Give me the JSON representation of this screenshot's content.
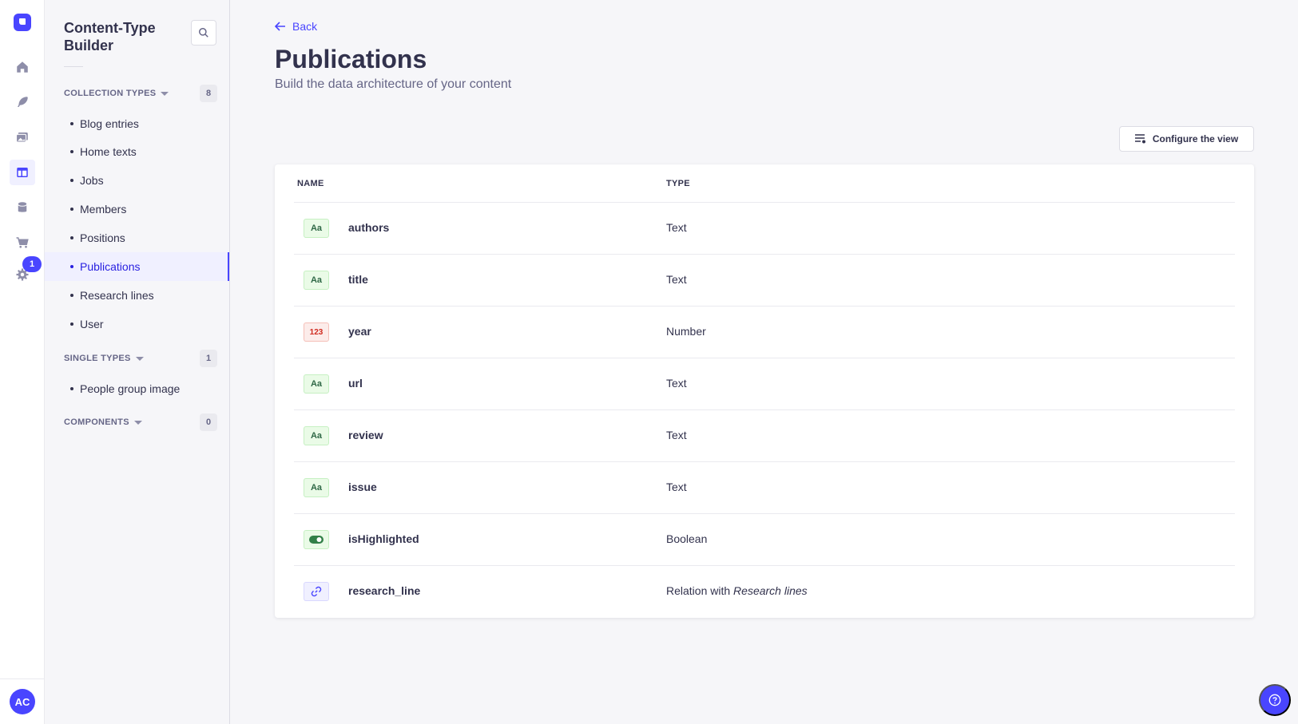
{
  "rail": {
    "avatar_initials": "AC",
    "settings_badge": "1",
    "items": [
      {
        "icon": "house-icon"
      },
      {
        "icon": "feather-icon"
      },
      {
        "icon": "media-icon"
      },
      {
        "icon": "layout-icon",
        "active": true
      },
      {
        "icon": "database-icon"
      },
      {
        "icon": "cart-icon"
      },
      {
        "icon": "gear-icon"
      }
    ]
  },
  "panel": {
    "title": "Content-Type Builder",
    "sections": {
      "collection": {
        "label": "COLLECTION TYPES",
        "count": "8"
      },
      "single": {
        "label": "SINGLE TYPES",
        "count": "1"
      },
      "components": {
        "label": "COMPONENTS",
        "count": "0"
      }
    },
    "collection_items": [
      "Blog entries",
      "Home texts",
      "Jobs",
      "Members",
      "Positions",
      "Publications",
      "Research lines",
      "User"
    ],
    "single_items": [
      "People group image"
    ]
  },
  "main": {
    "back_label": "Back",
    "title": "Publications",
    "subtitle": "Build the data architecture of your content",
    "configure_label": "Configure the view",
    "columns": {
      "name": "NAME",
      "type": "TYPE"
    },
    "fields": [
      {
        "name": "authors",
        "type": "Text",
        "icon": "Aa"
      },
      {
        "name": "title",
        "type": "Text",
        "icon": "Aa"
      },
      {
        "name": "year",
        "type": "Number",
        "icon": "123"
      },
      {
        "name": "url",
        "type": "Text",
        "icon": "Aa"
      },
      {
        "name": "review",
        "type": "Text",
        "icon": "Aa"
      },
      {
        "name": "issue",
        "type": "Text",
        "icon": "Aa"
      },
      {
        "name": "isHighlighted",
        "type": "Boolean",
        "icon": "toggle-icon"
      },
      {
        "name": "research_line",
        "type_prefix": "Relation with ",
        "type_target": "Research lines",
        "icon": "link-icon"
      }
    ]
  },
  "colors": {
    "accent": "#4945ff",
    "background": "#f6f6f9",
    "text": "#32324d"
  }
}
